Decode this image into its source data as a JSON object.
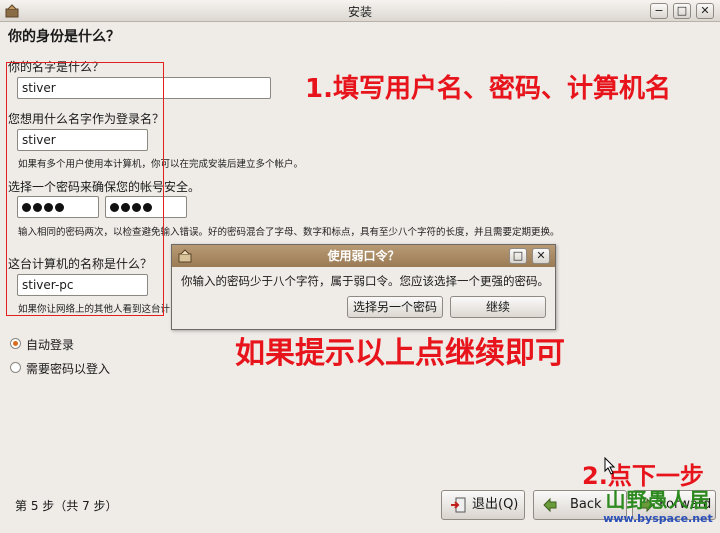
{
  "window": {
    "title": "安装",
    "minimize": "−",
    "maximize": "□",
    "close": "✕"
  },
  "page_title": "你的身份是什么？",
  "form": {
    "name_label": "你的名字是什么？",
    "name_value": "stiver",
    "login_label": "您想用什么名字作为登录名？",
    "login_value": "stiver",
    "login_hint": "如果有多个用户使用本计算机，你可以在完成安装后建立多个帐户。",
    "password_label": "选择一个密码来确保您的帐号安全。",
    "password_hint": "输入相同的密码两次，以检查避免输入错误。好的密码混合了字母、数字和标点，具有至少八个字符的长度，并且需要定期更换。",
    "computer_label": "这台计算机的名称是什么？",
    "computer_value": "stiver-pc",
    "computer_hint": "如果你让网络上的其他人看到这台计"
  },
  "login_options": {
    "auto_login": "自动登录",
    "require_password": "需要密码以登入"
  },
  "dialog": {
    "title": "使用弱口令？",
    "message": "你输入的密码少于八个字符，属于弱口令。您应该选择一个更强的密码。",
    "choose_other": "选择另一个密码",
    "continue": "继续",
    "restore": "□",
    "close": "✕"
  },
  "footer": {
    "step": "第 5 步（共 7 步）",
    "quit": "退出(Q)",
    "back": "Back",
    "forward": "Forward"
  },
  "annotations": {
    "step1": "1.填写用户名、密码、计算机名",
    "hint_continue": "如果提示以上点继续即可",
    "step2": "2.点下一步"
  },
  "watermark": {
    "site_name": "山野愚人居",
    "url": "www.byspace.net"
  },
  "colors": {
    "annotation_red": "#e8141c",
    "dialog_title": "#9a7b55",
    "radio_accent": "#d96b1c"
  }
}
